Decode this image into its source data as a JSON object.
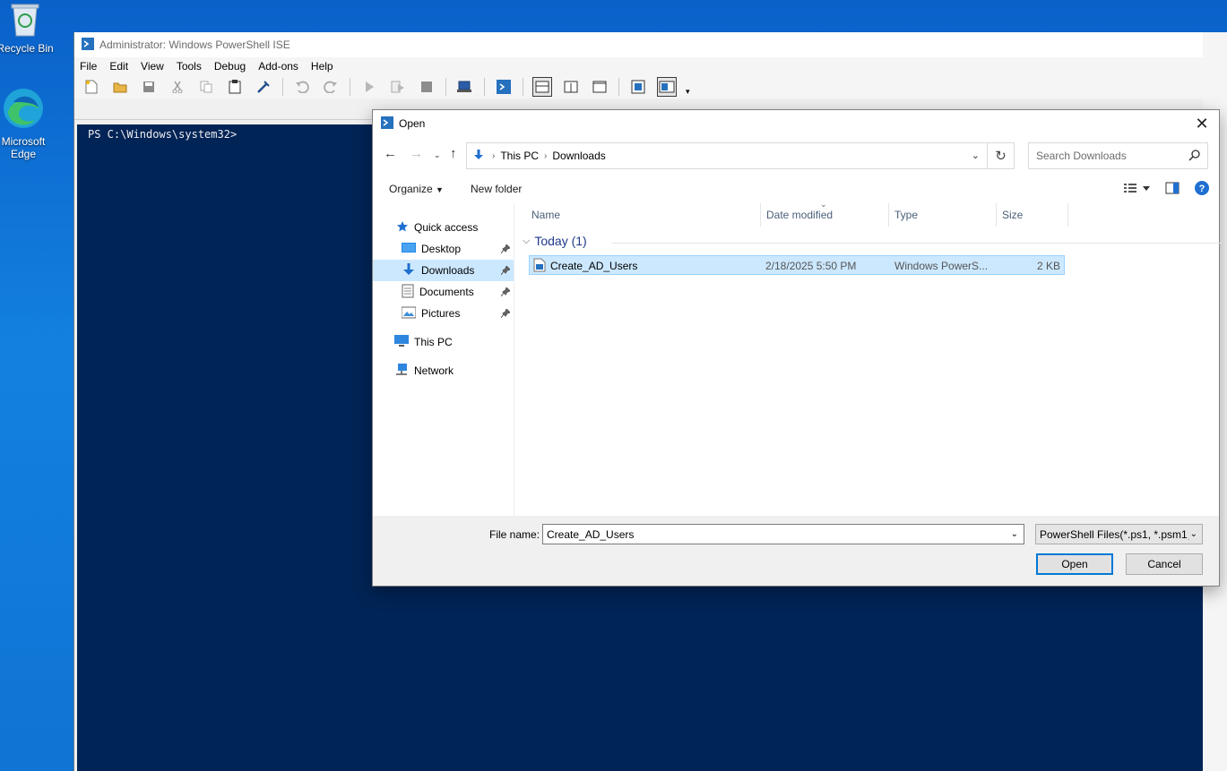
{
  "desktop": {
    "icons": [
      {
        "label": "Recycle Bin"
      },
      {
        "label": "Microsoft Edge"
      }
    ]
  },
  "ise": {
    "title": "Administrator: Windows PowerShell ISE",
    "menu": [
      "File",
      "Edit",
      "View",
      "Tools",
      "Debug",
      "Add-ons",
      "Help"
    ],
    "console_prompt": "PS C:\\Windows\\system32>"
  },
  "dialog": {
    "title": "Open",
    "address": {
      "crumbs": [
        "This PC",
        "Downloads"
      ]
    },
    "search_placeholder": "Search Downloads",
    "commands": {
      "organize": "Organize",
      "new_folder": "New folder"
    },
    "nav": {
      "quick_access": "Quick access",
      "items": [
        "Desktop",
        "Downloads",
        "Documents",
        "Pictures"
      ],
      "this_pc": "This PC",
      "network": "Network"
    },
    "columns": {
      "name": "Name",
      "date": "Date modified",
      "type": "Type",
      "size": "Size"
    },
    "group": "Today (1)",
    "files": [
      {
        "name": "Create_AD_Users",
        "date": "2/18/2025 5:50 PM",
        "type": "Windows PowerS...",
        "size": "2 KB"
      }
    ],
    "filename_label": "File name:",
    "filename_value": "Create_AD_Users",
    "filter": "PowerShell Files(*.ps1, *.psm1, *",
    "open_button": "Open",
    "cancel_button": "Cancel"
  },
  "colors": {
    "console_bg": "#012456",
    "selection": "#cce8ff",
    "accent": "#0078d7"
  }
}
